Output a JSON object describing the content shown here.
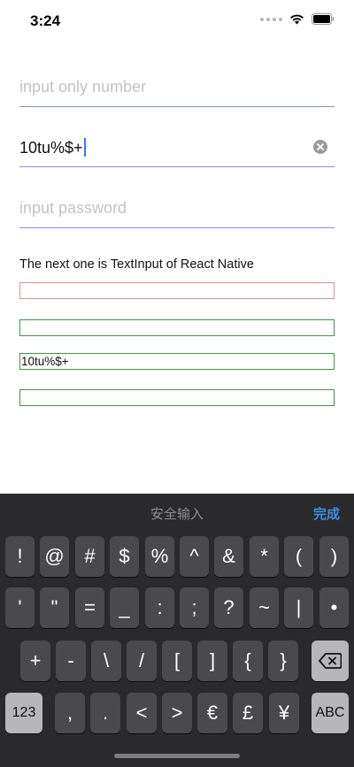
{
  "status_bar": {
    "time": "3:24"
  },
  "form": {
    "number_input": {
      "placeholder": "input only number",
      "value": ""
    },
    "text_input": {
      "value": "10tu%$+"
    },
    "password_input": {
      "placeholder": "input password",
      "value": ""
    },
    "caption": "The next one is TextInput of React Native",
    "rn_inputs": [
      {
        "value": ""
      },
      {
        "value": ""
      },
      {
        "value": "10tu%$+"
      },
      {
        "value": ""
      }
    ]
  },
  "keyboard": {
    "title": "安全输入",
    "done_label": "完成",
    "row1": [
      "!",
      "@",
      "#",
      "$",
      "%",
      "^",
      "&",
      "*",
      "(",
      ")"
    ],
    "row2": [
      "'",
      "\"",
      "=",
      "_",
      ":",
      ";",
      "?",
      "~",
      "|",
      "•"
    ],
    "row3": [
      "+",
      "-",
      "\\",
      "/",
      "[",
      "]",
      "{",
      "}"
    ],
    "row4": [
      ",",
      ".",
      "<",
      ">",
      "€",
      "£",
      "¥"
    ],
    "mode_label": "123",
    "abc_label": "ABC"
  },
  "colors": {
    "accent_underline": "#8a8df2",
    "done_blue": "#3d8ddf",
    "rn_red_border": "#f08a8a",
    "rn_green_border": "#3d9a3d"
  }
}
